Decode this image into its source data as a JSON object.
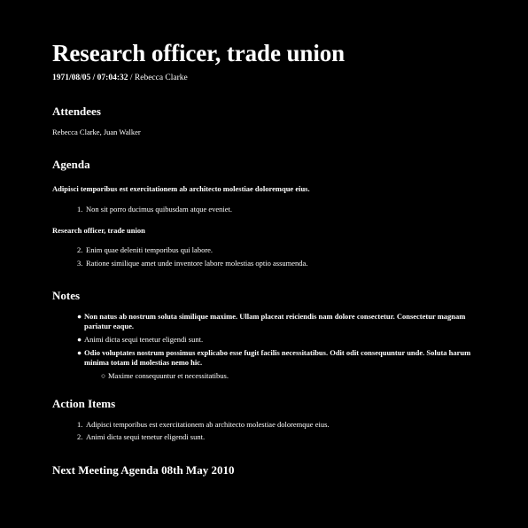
{
  "document": {
    "title": "Research officer, trade union",
    "meta_date_time": "1971/08/05 / 07:04:32",
    "meta_separator": " / ",
    "meta_author": "Rebecca Clarke"
  },
  "attendees": {
    "heading": "Attendees",
    "names": "Rebecca Clarke, Juan Walker"
  },
  "agenda": {
    "heading": "Agenda",
    "group1_title": "Adipisci temporibus est exercitationem ab architecto molestiae doloremque eius.",
    "group1_items": [
      {
        "num": "1.",
        "text": "Non sit porro ducimus quibusdam atque eveniet."
      }
    ],
    "group2_title": "Research officer, trade union",
    "group2_items": [
      {
        "num": "2.",
        "text": "Enim quae deleniti temporibus qui labore."
      },
      {
        "num": "3.",
        "text": "Ratione similique amet unde inventore labore molestias optio assumenda."
      }
    ]
  },
  "notes": {
    "heading": "Notes",
    "bullet": "●",
    "sub_bullet": "○",
    "items": [
      "Non natus ab nostrum soluta similique maxime. Ullam placeat reiciendis nam dolore consectetur. Consectetur magnam pariatur eaque.",
      "Animi dicta sequi tenetur eligendi sunt.",
      "Odio voluptates nostrum possimus explicabo esse fugit facilis necessitatibus. Odit odit consequuntur unde. Soluta harum minima totam id molestias nemo hic."
    ],
    "sub_items": [
      "Maxime consequuntur et necessitatibus."
    ]
  },
  "action_items": {
    "heading": "Action Items",
    "items": [
      {
        "num": "1.",
        "text": "Adipisci temporibus est exercitationem ab architecto molestiae doloremque eius."
      },
      {
        "num": "2.",
        "text": "Animi dicta sequi tenetur eligendi sunt."
      }
    ]
  },
  "next_meeting": {
    "heading": "Next Meeting Agenda 08th May 2010"
  }
}
